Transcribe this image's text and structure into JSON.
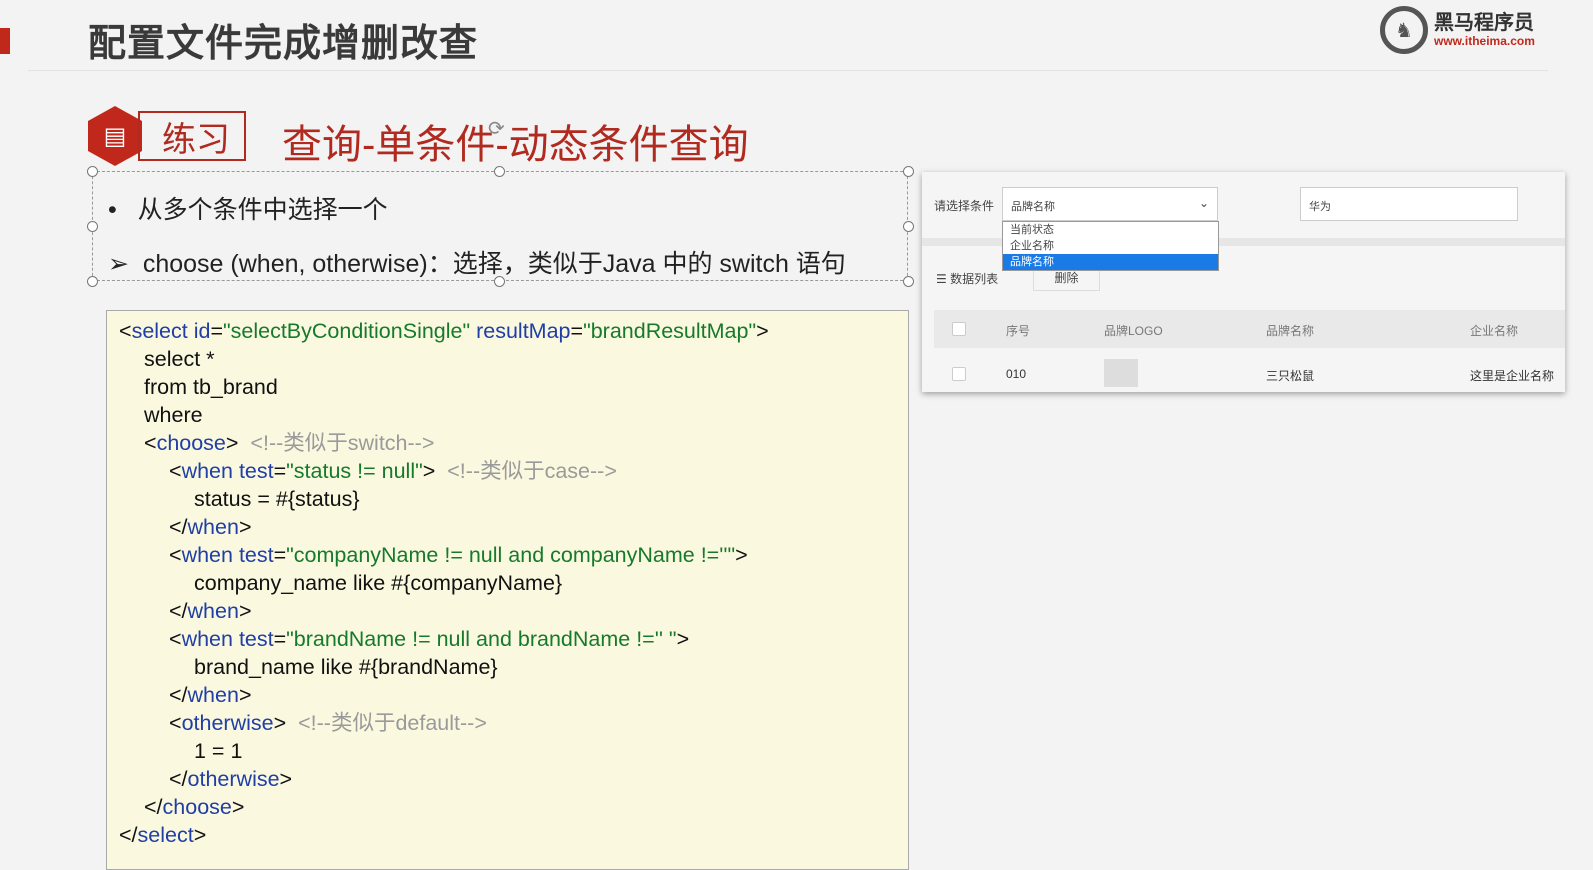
{
  "slide": {
    "title": "配置文件完成增删改查",
    "badge": "练习",
    "subtitle": "查询-单条件-动态条件查询",
    "bullets": [
      "从多个条件中选择一个",
      "choose (when, otherwise)：选择，类似于Java 中的 switch 语句"
    ]
  },
  "logo": {
    "name": "黑马程序员",
    "url": "www.itheima.com"
  },
  "colors": {
    "accent": "#c0281c",
    "tag": "#1f3fa6",
    "value": "#167a2c",
    "comment": "#9a9a9a",
    "code_bg": "#fbf8e0"
  },
  "code": [
    {
      "i": 0,
      "t": [
        [
          "k",
          "<"
        ],
        [
          "b",
          "select "
        ],
        [
          "b",
          "id"
        ],
        [
          "k",
          "="
        ],
        [
          "g",
          "\"selectByConditionSingle\" "
        ],
        [
          "b",
          "resultMap"
        ],
        [
          "k",
          "="
        ],
        [
          "g",
          "\"brandResultMap\""
        ],
        [
          "k",
          ">"
        ]
      ]
    },
    {
      "i": 1,
      "t": [
        [
          "k",
          "select *"
        ]
      ]
    },
    {
      "i": 1,
      "t": [
        [
          "k",
          "from tb_brand"
        ]
      ]
    },
    {
      "i": 1,
      "t": [
        [
          "k",
          "where"
        ]
      ]
    },
    {
      "i": 1,
      "t": [
        [
          "k",
          "<"
        ],
        [
          "b",
          "choose"
        ],
        [
          "k",
          ">  "
        ],
        [
          "c",
          "<!--类似于switch-->"
        ]
      ]
    },
    {
      "i": 2,
      "t": [
        [
          "k",
          "<"
        ],
        [
          "b",
          "when "
        ],
        [
          "b",
          "test"
        ],
        [
          "k",
          "="
        ],
        [
          "g",
          "\"status != null\""
        ],
        [
          "k",
          ">  "
        ],
        [
          "c",
          "<!--类似于case-->"
        ]
      ]
    },
    {
      "i": 3,
      "t": [
        [
          "k",
          "status = #{status}"
        ]
      ]
    },
    {
      "i": 2,
      "t": [
        [
          "k",
          "</"
        ],
        [
          "b",
          "when"
        ],
        [
          "k",
          ">"
        ]
      ]
    },
    {
      "i": 2,
      "t": [
        [
          "k",
          "<"
        ],
        [
          "b",
          "when "
        ],
        [
          "b",
          "test"
        ],
        [
          "k",
          "="
        ],
        [
          "g",
          "\"companyName != null and companyName !=''\""
        ],
        [
          "k",
          ">"
        ]
      ]
    },
    {
      "i": 3,
      "t": [
        [
          "k",
          "company_name like #{companyName}"
        ]
      ]
    },
    {
      "i": 2,
      "t": [
        [
          "k",
          "</"
        ],
        [
          "b",
          "when"
        ],
        [
          "k",
          ">"
        ]
      ]
    },
    {
      "i": 2,
      "t": [
        [
          "k",
          "<"
        ],
        [
          "b",
          "when "
        ],
        [
          "b",
          "test"
        ],
        [
          "k",
          "="
        ],
        [
          "g",
          "\"brandName != null and brandName !='' \""
        ],
        [
          "k",
          ">"
        ]
      ]
    },
    {
      "i": 3,
      "t": [
        [
          "k",
          "brand_name like #{brandName}"
        ]
      ]
    },
    {
      "i": 2,
      "t": [
        [
          "k",
          "</"
        ],
        [
          "b",
          "when"
        ],
        [
          "k",
          ">"
        ]
      ]
    },
    {
      "i": 2,
      "t": [
        [
          "k",
          "<"
        ],
        [
          "b",
          "otherwise"
        ],
        [
          "k",
          ">  "
        ],
        [
          "c",
          "<!--类似于default-->"
        ]
      ]
    },
    {
      "i": 3,
      "t": [
        [
          "k",
          "1 = 1"
        ]
      ]
    },
    {
      "i": 2,
      "t": [
        [
          "k",
          "</"
        ],
        [
          "b",
          "otherwise"
        ],
        [
          "k",
          ">"
        ]
      ]
    },
    {
      "i": 1,
      "t": [
        [
          "k",
          "</"
        ],
        [
          "b",
          "choose"
        ],
        [
          "k",
          ">"
        ]
      ]
    },
    {
      "i": 0,
      "t": [
        [
          "k",
          "</"
        ],
        [
          "b",
          "select"
        ],
        [
          "k",
          ">"
        ]
      ]
    }
  ],
  "demo": {
    "condition_label": "请选择条件",
    "select_value": "品牌名称",
    "input_value": "华为",
    "options": [
      "当前状态",
      "企业名称",
      "品牌名称"
    ],
    "selected_option": "品牌名称",
    "list_label": "数据列表",
    "delete_label": "删除",
    "headers": [
      "序号",
      "品牌LOGO",
      "品牌名称",
      "企业名称"
    ],
    "row": {
      "id": "010",
      "brand": "三只松鼠",
      "company": "这里是企业名称"
    }
  }
}
